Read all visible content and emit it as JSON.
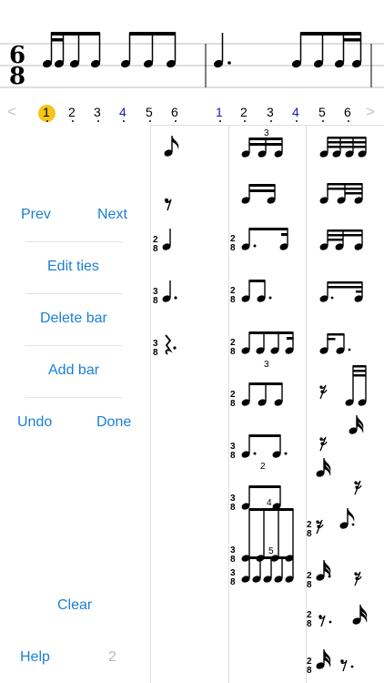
{
  "time_signature": {
    "top": "6",
    "bottom": "8"
  },
  "ruler": {
    "prev_chevron": "<",
    "next_chevron": ">",
    "bar1": [
      "1",
      "2",
      "3",
      "4",
      "5",
      "6"
    ],
    "bar2": [
      "1",
      "2",
      "3",
      "4",
      "5",
      "6"
    ],
    "highlight_color": "#f5c518"
  },
  "controls": {
    "prev": "Prev",
    "next": "Next",
    "edit_ties": "Edit ties",
    "delete_bar": "Delete bar",
    "add_bar": "Add bar",
    "undo": "Undo",
    "done": "Done",
    "clear": "Clear",
    "help": "Help",
    "bar_count": "2"
  },
  "palette": {
    "ts_top": "2",
    "ts_top_3": "3",
    "ts_bottom": "8",
    "tuplets": {
      "triplet": "3",
      "duplet": "2",
      "quad": "4",
      "quint": "5"
    }
  },
  "colors": {
    "accent": "#1a7fd4",
    "separator": "#dedede",
    "muted": "#b8b8b8"
  }
}
